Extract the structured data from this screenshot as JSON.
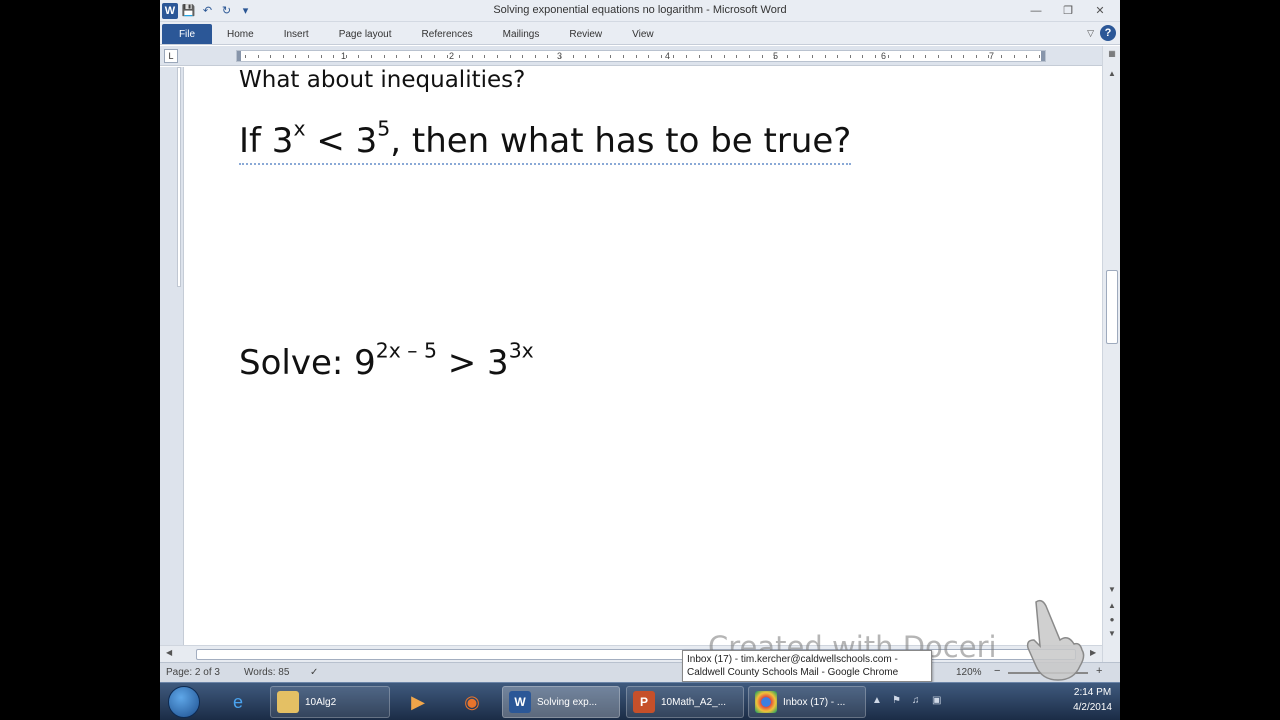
{
  "window": {
    "title": "Solving exponential equations no logarithm  -  Microsoft Word",
    "app_icon": "W"
  },
  "ribbon": {
    "tabs": [
      "File",
      "Home",
      "Insert",
      "Page layout",
      "References",
      "Mailings",
      "Review",
      "View"
    ],
    "help": "?"
  },
  "ruler": {
    "numbers": [
      "1",
      "2",
      "3",
      "4",
      "5",
      "6",
      "7"
    ],
    "tab_selector": "L"
  },
  "document": {
    "line1": "What about inequalities?",
    "line2": {
      "pre": "If 3",
      "sup1": "x",
      "mid": " < 3",
      "sup2": "5",
      "post": ", then what has to be true?"
    },
    "line3": {
      "pre": "Solve:  9",
      "sup1": "2x – 5",
      "mid": " > 3",
      "sup2": "3x"
    }
  },
  "status_bar": {
    "page": "Page: 2 of 3",
    "words": "Words: 85",
    "zoom": "120%"
  },
  "watermark": "Created with Doceri",
  "tooltip": {
    "line1": "Inbox (17) - tim.kercher@caldwellschools.com -",
    "line2": "Caldwell County Schools Mail - Google Chrome"
  },
  "taskbar": {
    "items": [
      {
        "label": "10Alg2",
        "icon": "folder-icon"
      },
      {
        "label": "Solving exp...",
        "icon": "word-icon"
      },
      {
        "label": "10Math_A2_...",
        "icon": "powerpoint-icon"
      },
      {
        "label": "Inbox (17) - ...",
        "icon": "chrome-icon"
      }
    ],
    "clock_time": "2:14 PM",
    "clock_date": "4/2/2014"
  }
}
